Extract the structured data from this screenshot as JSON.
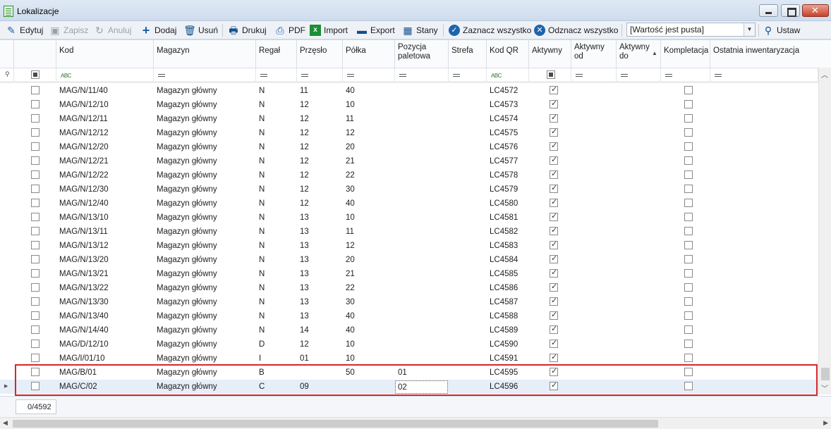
{
  "window": {
    "title": "Lokalizacje"
  },
  "toolbar": {
    "edit": "Edytuj",
    "save": "Zapisz",
    "cancel": "Anuluj",
    "add": "Dodaj",
    "delete": "Usuń",
    "print": "Drukuj",
    "pdf": "PDF",
    "import": "Import",
    "export": "Export",
    "stock": "Stany",
    "select_all": "Zaznacz wszystko",
    "deselect_all": "Odznacz wszystko",
    "value_dropdown": "[Wartość jest pusta]",
    "set": "Ustaw"
  },
  "columns": {
    "kod": "Kod",
    "magazyn": "Magazyn",
    "regal": "Regał",
    "przeslo": "Przęsło",
    "polka": "Półka",
    "pozycja": "Pozycja paletowa",
    "strefa": "Strefa",
    "kodqr": "Kod QR",
    "aktywny": "Aktywny",
    "aktywny_od": "Aktywny od",
    "aktywny_do": "Aktywny do",
    "kompletacja": "Kompletacja",
    "inwentaryzacja": "Ostatnia inwentaryzacja"
  },
  "rows": [
    {
      "kod": "MAG/N/11/40",
      "magazyn": "Magazyn główny",
      "regal": "N",
      "przeslo": "11",
      "polka": "40",
      "pozycja": "",
      "kodqr": "LC4572",
      "aktywny": true,
      "kompletacja": false
    },
    {
      "kod": "MAG/N/12/10",
      "magazyn": "Magazyn główny",
      "regal": "N",
      "przeslo": "12",
      "polka": "10",
      "pozycja": "",
      "kodqr": "LC4573",
      "aktywny": true,
      "kompletacja": false
    },
    {
      "kod": "MAG/N/12/11",
      "magazyn": "Magazyn główny",
      "regal": "N",
      "przeslo": "12",
      "polka": "11",
      "pozycja": "",
      "kodqr": "LC4574",
      "aktywny": true,
      "kompletacja": false
    },
    {
      "kod": "MAG/N/12/12",
      "magazyn": "Magazyn główny",
      "regal": "N",
      "przeslo": "12",
      "polka": "12",
      "pozycja": "",
      "kodqr": "LC4575",
      "aktywny": true,
      "kompletacja": false
    },
    {
      "kod": "MAG/N/12/20",
      "magazyn": "Magazyn główny",
      "regal": "N",
      "przeslo": "12",
      "polka": "20",
      "pozycja": "",
      "kodqr": "LC4576",
      "aktywny": true,
      "kompletacja": false
    },
    {
      "kod": "MAG/N/12/21",
      "magazyn": "Magazyn główny",
      "regal": "N",
      "przeslo": "12",
      "polka": "21",
      "pozycja": "",
      "kodqr": "LC4577",
      "aktywny": true,
      "kompletacja": false
    },
    {
      "kod": "MAG/N/12/22",
      "magazyn": "Magazyn główny",
      "regal": "N",
      "przeslo": "12",
      "polka": "22",
      "pozycja": "",
      "kodqr": "LC4578",
      "aktywny": true,
      "kompletacja": false
    },
    {
      "kod": "MAG/N/12/30",
      "magazyn": "Magazyn główny",
      "regal": "N",
      "przeslo": "12",
      "polka": "30",
      "pozycja": "",
      "kodqr": "LC4579",
      "aktywny": true,
      "kompletacja": false
    },
    {
      "kod": "MAG/N/12/40",
      "magazyn": "Magazyn główny",
      "regal": "N",
      "przeslo": "12",
      "polka": "40",
      "pozycja": "",
      "kodqr": "LC4580",
      "aktywny": true,
      "kompletacja": false
    },
    {
      "kod": "MAG/N/13/10",
      "magazyn": "Magazyn główny",
      "regal": "N",
      "przeslo": "13",
      "polka": "10",
      "pozycja": "",
      "kodqr": "LC4581",
      "aktywny": true,
      "kompletacja": false
    },
    {
      "kod": "MAG/N/13/11",
      "magazyn": "Magazyn główny",
      "regal": "N",
      "przeslo": "13",
      "polka": "11",
      "pozycja": "",
      "kodqr": "LC4582",
      "aktywny": true,
      "kompletacja": false
    },
    {
      "kod": "MAG/N/13/12",
      "magazyn": "Magazyn główny",
      "regal": "N",
      "przeslo": "13",
      "polka": "12",
      "pozycja": "",
      "kodqr": "LC4583",
      "aktywny": true,
      "kompletacja": false
    },
    {
      "kod": "MAG/N/13/20",
      "magazyn": "Magazyn główny",
      "regal": "N",
      "przeslo": "13",
      "polka": "20",
      "pozycja": "",
      "kodqr": "LC4584",
      "aktywny": true,
      "kompletacja": false
    },
    {
      "kod": "MAG/N/13/21",
      "magazyn": "Magazyn główny",
      "regal": "N",
      "przeslo": "13",
      "polka": "21",
      "pozycja": "",
      "kodqr": "LC4585",
      "aktywny": true,
      "kompletacja": false
    },
    {
      "kod": "MAG/N/13/22",
      "magazyn": "Magazyn główny",
      "regal": "N",
      "przeslo": "13",
      "polka": "22",
      "pozycja": "",
      "kodqr": "LC4586",
      "aktywny": true,
      "kompletacja": false
    },
    {
      "kod": "MAG/N/13/30",
      "magazyn": "Magazyn główny",
      "regal": "N",
      "przeslo": "13",
      "polka": "30",
      "pozycja": "",
      "kodqr": "LC4587",
      "aktywny": true,
      "kompletacja": false
    },
    {
      "kod": "MAG/N/13/40",
      "magazyn": "Magazyn główny",
      "regal": "N",
      "przeslo": "13",
      "polka": "40",
      "pozycja": "",
      "kodqr": "LC4588",
      "aktywny": true,
      "kompletacja": false
    },
    {
      "kod": "MAG/N/14/40",
      "magazyn": "Magazyn główny",
      "regal": "N",
      "przeslo": "14",
      "polka": "40",
      "pozycja": "",
      "kodqr": "LC4589",
      "aktywny": true,
      "kompletacja": false
    },
    {
      "kod": "MAG/D/12/10",
      "magazyn": "Magazyn główny",
      "regal": "D",
      "przeslo": "12",
      "polka": "10",
      "pozycja": "",
      "kodqr": "LC4590",
      "aktywny": true,
      "kompletacja": false
    },
    {
      "kod": "MAG/I/01/10",
      "magazyn": "Magazyn główny",
      "regal": "I",
      "przeslo": "01",
      "polka": "10",
      "pozycja": "",
      "kodqr": "LC4591",
      "aktywny": true,
      "kompletacja": false
    },
    {
      "kod": "MAG/B/01",
      "magazyn": "Magazyn główny",
      "regal": "B",
      "przeslo": "",
      "polka": "50",
      "pozycja": "01",
      "kodqr": "LC4595",
      "aktywny": true,
      "kompletacja": false
    },
    {
      "kod": "MAG/C/02",
      "magazyn": "Magazyn główny",
      "regal": "C",
      "przeslo": "09",
      "polka": "",
      "pozycja": "02",
      "kodqr": "LC4596",
      "aktywny": true,
      "kompletacja": false
    }
  ],
  "footer": {
    "counter": "0/4592"
  },
  "colors": {
    "highlight": "#d7262b",
    "selected_row": "#e6eef8",
    "accent": "#1d64ad"
  }
}
